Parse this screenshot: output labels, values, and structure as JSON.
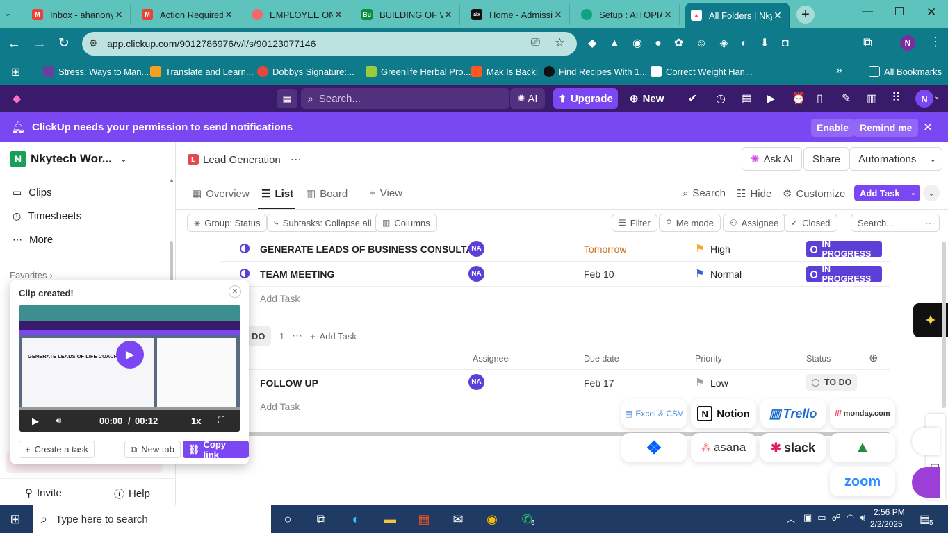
{
  "browser": {
    "tabs": [
      {
        "title": "Inbox - ahanony",
        "favicon": "gmail-icon",
        "color": "#ea4335"
      },
      {
        "title": "Action Required",
        "favicon": "gmail-icon",
        "color": "#ea4335"
      },
      {
        "title": "EMPLOYEE ONB",
        "favicon": "asana-icon",
        "color": "#f06a6a"
      },
      {
        "title": "BUILDING OF W",
        "favicon": "bu-icon",
        "color": "#0a8f3c"
      },
      {
        "title": "Home - Admissi",
        "favicon": "alx-icon",
        "color": "#111111"
      },
      {
        "title": "Setup : AITOPIA",
        "favicon": "chatgpt-icon",
        "color": "#10a37f"
      },
      {
        "title": "All Folders | Nky",
        "favicon": "clickup-icon",
        "color": "#ff3d71"
      }
    ],
    "url": "app.clickup.com/9012786976/v/l/s/90123077146",
    "profile_initial": "N",
    "bookmarks": [
      "Stress: Ways to Man...",
      "Translate and Learn...",
      "Dobbys Signature:...",
      "Greenlife Herbal Pro...",
      "Mak Is Back!",
      "Find Recipes With 1...",
      "Correct Weight Han..."
    ],
    "all_bookmarks": "All Bookmarks"
  },
  "header": {
    "search_placeholder": "Search...",
    "ai_label": "AI",
    "upgrade_label": "Upgrade",
    "new_label": "New",
    "avatar": "N"
  },
  "notification": {
    "message": "ClickUp needs your permission to send notifications",
    "enable": "Enable",
    "remind": "Remind me"
  },
  "sidebar": {
    "workspace_initial": "N",
    "workspace_name": "Nkytech Wor...",
    "items": [
      "Clips",
      "Timesheets",
      "More"
    ],
    "favorites": "Favorites",
    "invite": "Invite",
    "help": "Help"
  },
  "breadcrumb": {
    "badge": "L",
    "list_name": "Lead Generation",
    "ask_ai": "Ask AI",
    "share": "Share",
    "automations": "Automations"
  },
  "views": {
    "overview": "Overview",
    "list": "List",
    "board": "Board",
    "add_view": "View",
    "search": "Search",
    "hide": "Hide",
    "customize": "Customize",
    "add_task": "Add Task"
  },
  "filters": {
    "group": "Group: Status",
    "subtasks": "Subtasks: Collapse all",
    "columns": "Columns",
    "filter": "Filter",
    "me_mode": "Me mode",
    "assignee": "Assignee",
    "closed": "Closed",
    "search_placeholder": "Search..."
  },
  "in_progress_tasks": [
    {
      "name": "GENERATE LEADS OF BUSINESS CONSULTA...",
      "assignee": "NA",
      "due": "Tomorrow",
      "priority": "High",
      "status": "IN PROGRESS"
    },
    {
      "name": "TEAM MEETING",
      "assignee": "NA",
      "due": "Feb 10",
      "priority": "Normal",
      "status": "IN PROGRESS"
    }
  ],
  "add_task_label": "Add Task",
  "todo_group": {
    "label": "DO",
    "count": "1",
    "add_task": "Add Task",
    "columns": {
      "assignee": "Assignee",
      "due": "Due date",
      "priority": "Priority",
      "status": "Status"
    },
    "tasks": [
      {
        "name": "FOLLOW UP",
        "assignee": "NA",
        "due": "Feb 17",
        "priority": "Low",
        "status": "TO DO"
      }
    ]
  },
  "integrations": [
    "Excel & CSV",
    "Notion",
    "Trello",
    "monday.com",
    "asana",
    "slack",
    "zoom"
  ],
  "clip_popup": {
    "title": "Clip created!",
    "preview_heading": "GENERATE LEADS OF LIFE COACHES IN US",
    "time_current": "00:00",
    "time_total": "00:12",
    "speed": "1x",
    "create_task": "Create a task",
    "new_tab": "New tab",
    "copy_link": "Copy link"
  },
  "taskbar": {
    "search_placeholder": "Type here to search",
    "time": "2:56 PM",
    "date": "2/2/2025",
    "whatsapp_badge": "6",
    "notif_count": "5"
  },
  "colors": {
    "chrome_teal": "#0e7a8a",
    "clickup_purple": "#7b47f2",
    "status_in_progress": "#5b3fd6",
    "due_tomorrow": "#c8741c",
    "priority_high": "#f5a623",
    "priority_normal": "#3b5bdb",
    "priority_low": "#9e9e9e"
  }
}
